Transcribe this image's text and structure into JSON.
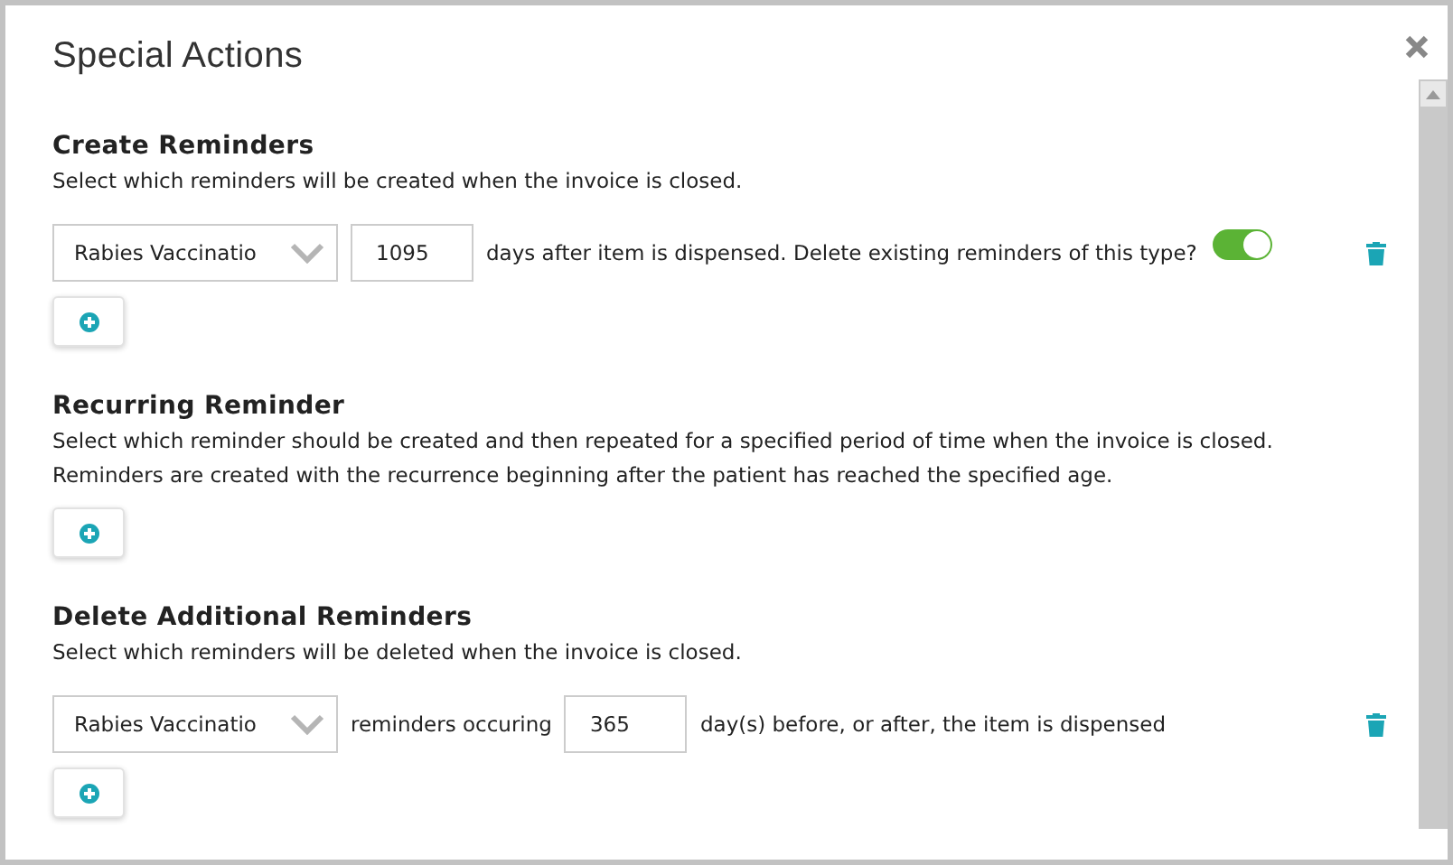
{
  "dialog": {
    "title": "Special Actions"
  },
  "sections": [
    {
      "heading": "Create Reminders",
      "descriptions": [
        "Select which reminders will be created when the invoice is closed."
      ],
      "rows": [
        {
          "kind": "create",
          "select": "Rabies Vaccinatio",
          "days": "1095",
          "text": "days after item is dispensed. Delete existing reminders of this type?",
          "toggle_on": true
        }
      ]
    },
    {
      "heading": "Recurring Reminder",
      "descriptions": [
        "Select which reminder should be created and then repeated for a specified period of time when the invoice is closed.",
        "Reminders are created with the recurrence beginning after the patient has reached the specified age."
      ]
    },
    {
      "heading": "Delete Additional Reminders",
      "descriptions": [
        "Select which reminders will be deleted when the invoice is closed."
      ],
      "rows": [
        {
          "kind": "delete",
          "select": "Rabies Vaccinatio",
          "text_before": "reminders occuring",
          "days": "365",
          "text_after": "day(s) before, or after, the item is dispensed"
        }
      ]
    }
  ]
}
